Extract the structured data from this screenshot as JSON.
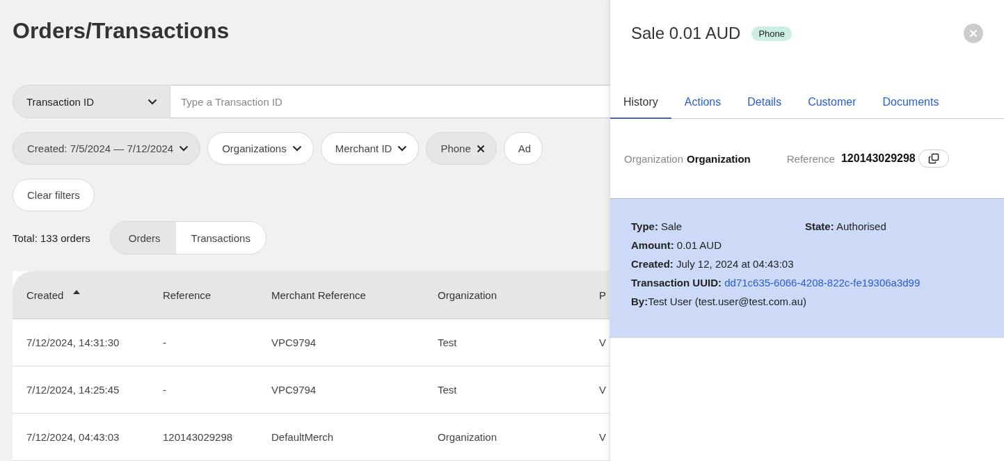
{
  "page": {
    "title": "Orders/Transactions"
  },
  "search": {
    "field_type": "Transaction ID",
    "placeholder": "Type a Transaction ID"
  },
  "filters": [
    {
      "label": "Created: 7/5/2024 — 7/12/2024",
      "kind": "dropdown",
      "active": true
    },
    {
      "label": "Organizations",
      "kind": "dropdown",
      "active": false
    },
    {
      "label": "Merchant ID",
      "kind": "dropdown",
      "active": false
    },
    {
      "label": "Phone",
      "kind": "removable",
      "active": true
    },
    {
      "label": "Ad",
      "kind": "plain",
      "active": false
    }
  ],
  "clear_filters": "Clear filters",
  "total": "Total: 133 orders",
  "view_tabs": [
    {
      "label": "Orders",
      "selected": true
    },
    {
      "label": "Transactions",
      "selected": false
    }
  ],
  "table": {
    "columns": [
      {
        "label": "Created",
        "sorted": true
      },
      {
        "label": "Reference",
        "sorted": false
      },
      {
        "label": "Merchant Reference",
        "sorted": false
      },
      {
        "label": "Organization",
        "sorted": false
      },
      {
        "label": "P",
        "sorted": false
      }
    ],
    "rows": [
      [
        "7/12/2024, 14:31:30",
        "-",
        "VPC9794",
        "Test",
        "V"
      ],
      [
        "7/12/2024, 14:25:45",
        "-",
        "VPC9794",
        "Test",
        "V"
      ],
      [
        "7/12/2024, 04:43:03",
        "120143029298",
        "DefaultMerch",
        "Organization",
        "V"
      ]
    ]
  },
  "drawer": {
    "title": "Sale 0.01 AUD",
    "badge": "Phone",
    "tabs": [
      {
        "label": "History",
        "selected": true
      },
      {
        "label": "Actions",
        "selected": false
      },
      {
        "label": "Details",
        "selected": false
      },
      {
        "label": "Customer",
        "selected": false
      },
      {
        "label": "Documents",
        "selected": false
      }
    ],
    "organization_label": "Organization",
    "organization_value": "Organization",
    "reference_label": "Reference",
    "reference_value": "120143029298",
    "details": [
      [
        {
          "text": "**Type:** Sale"
        },
        {
          "text": "**State:** Authorised"
        }
      ],
      [
        {
          "text": "**Amount:** 0.01 AUD"
        }
      ],
      [
        {
          "text": "**Created:** July 12, 2024 at 04:43:03"
        }
      ],
      [
        {
          "text": "**Transaction UUID:**",
          "link": "dd71c635-6066-4208-822c-fe19306a3d99"
        }
      ],
      [
        {
          "text": "**By:**Test User (test.user@test.com.au)"
        }
      ]
    ]
  }
}
